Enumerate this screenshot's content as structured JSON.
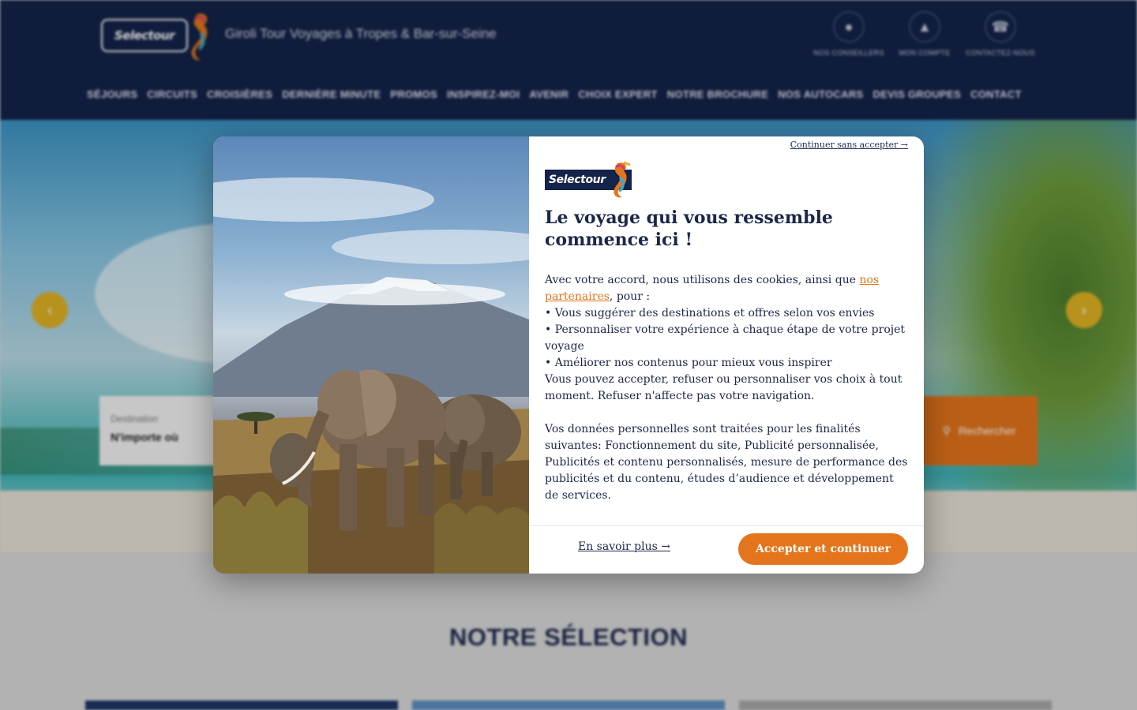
{
  "site": {
    "logo_text": "Selectour",
    "tagline": "Giroli Tour Voyages à Tropes & Bar-sur-Seine",
    "header_actions": [
      {
        "icon": "person-icon",
        "label": "Nos conseillers"
      },
      {
        "icon": "user-icon",
        "label": "Mon compte"
      },
      {
        "icon": "phone-icon",
        "label": "Contactez-nous"
      }
    ],
    "nav": [
      "SÉJOURS",
      "CIRCUITS",
      "CROISIÈRES",
      "DERNIÈRE MINUTE",
      "PROMOS",
      "INSPIREZ-MOI",
      "AVENIR",
      "CHOIX EXPERT",
      "NOTRE BROCHURE",
      "NOS AUTOCARS",
      "DEVIS GROUPES",
      "CONTACT"
    ],
    "search": {
      "field_label": "Destination",
      "field_value": "N'importe où",
      "button_label": "Rechercher"
    },
    "section_title": "NOTRE SÉLECTION",
    "colors": {
      "navy": "#132349",
      "orange": "#e5751c",
      "yellow": "#e0b323"
    }
  },
  "modal": {
    "skip_link": "Continuer sans accepter →",
    "logo_text": "Selectour",
    "title": "Le voyage qui vous ressemble commence ici !",
    "intro_before": "Avec votre accord, nous utilisons des cookies, ainsi que ",
    "partners_link": "nos partenaires",
    "intro_after": ", pour :",
    "bullets": [
      "• Vous suggérer des destinations et offres selon vos envies",
      "• Personnaliser votre expérience à chaque étape de votre projet voyage",
      "• Améliorer nos contenus pour mieux vous inspirer"
    ],
    "choice_text": "Vous pouvez accepter, refuser ou personnaliser vos choix à tout moment. Refuser n'affecte pas votre navigation.",
    "data_text": "Vos données personnelles sont traitées pour les finalités suivantes: Fonctionnement du site, Publicité personnalisée, Publicités et contenu personnalisés, mesure de performance des publicités et du contenu, études d’audience et développement de services.",
    "learn_more": "En savoir plus →",
    "accept_button": "Accepter et continuer"
  }
}
